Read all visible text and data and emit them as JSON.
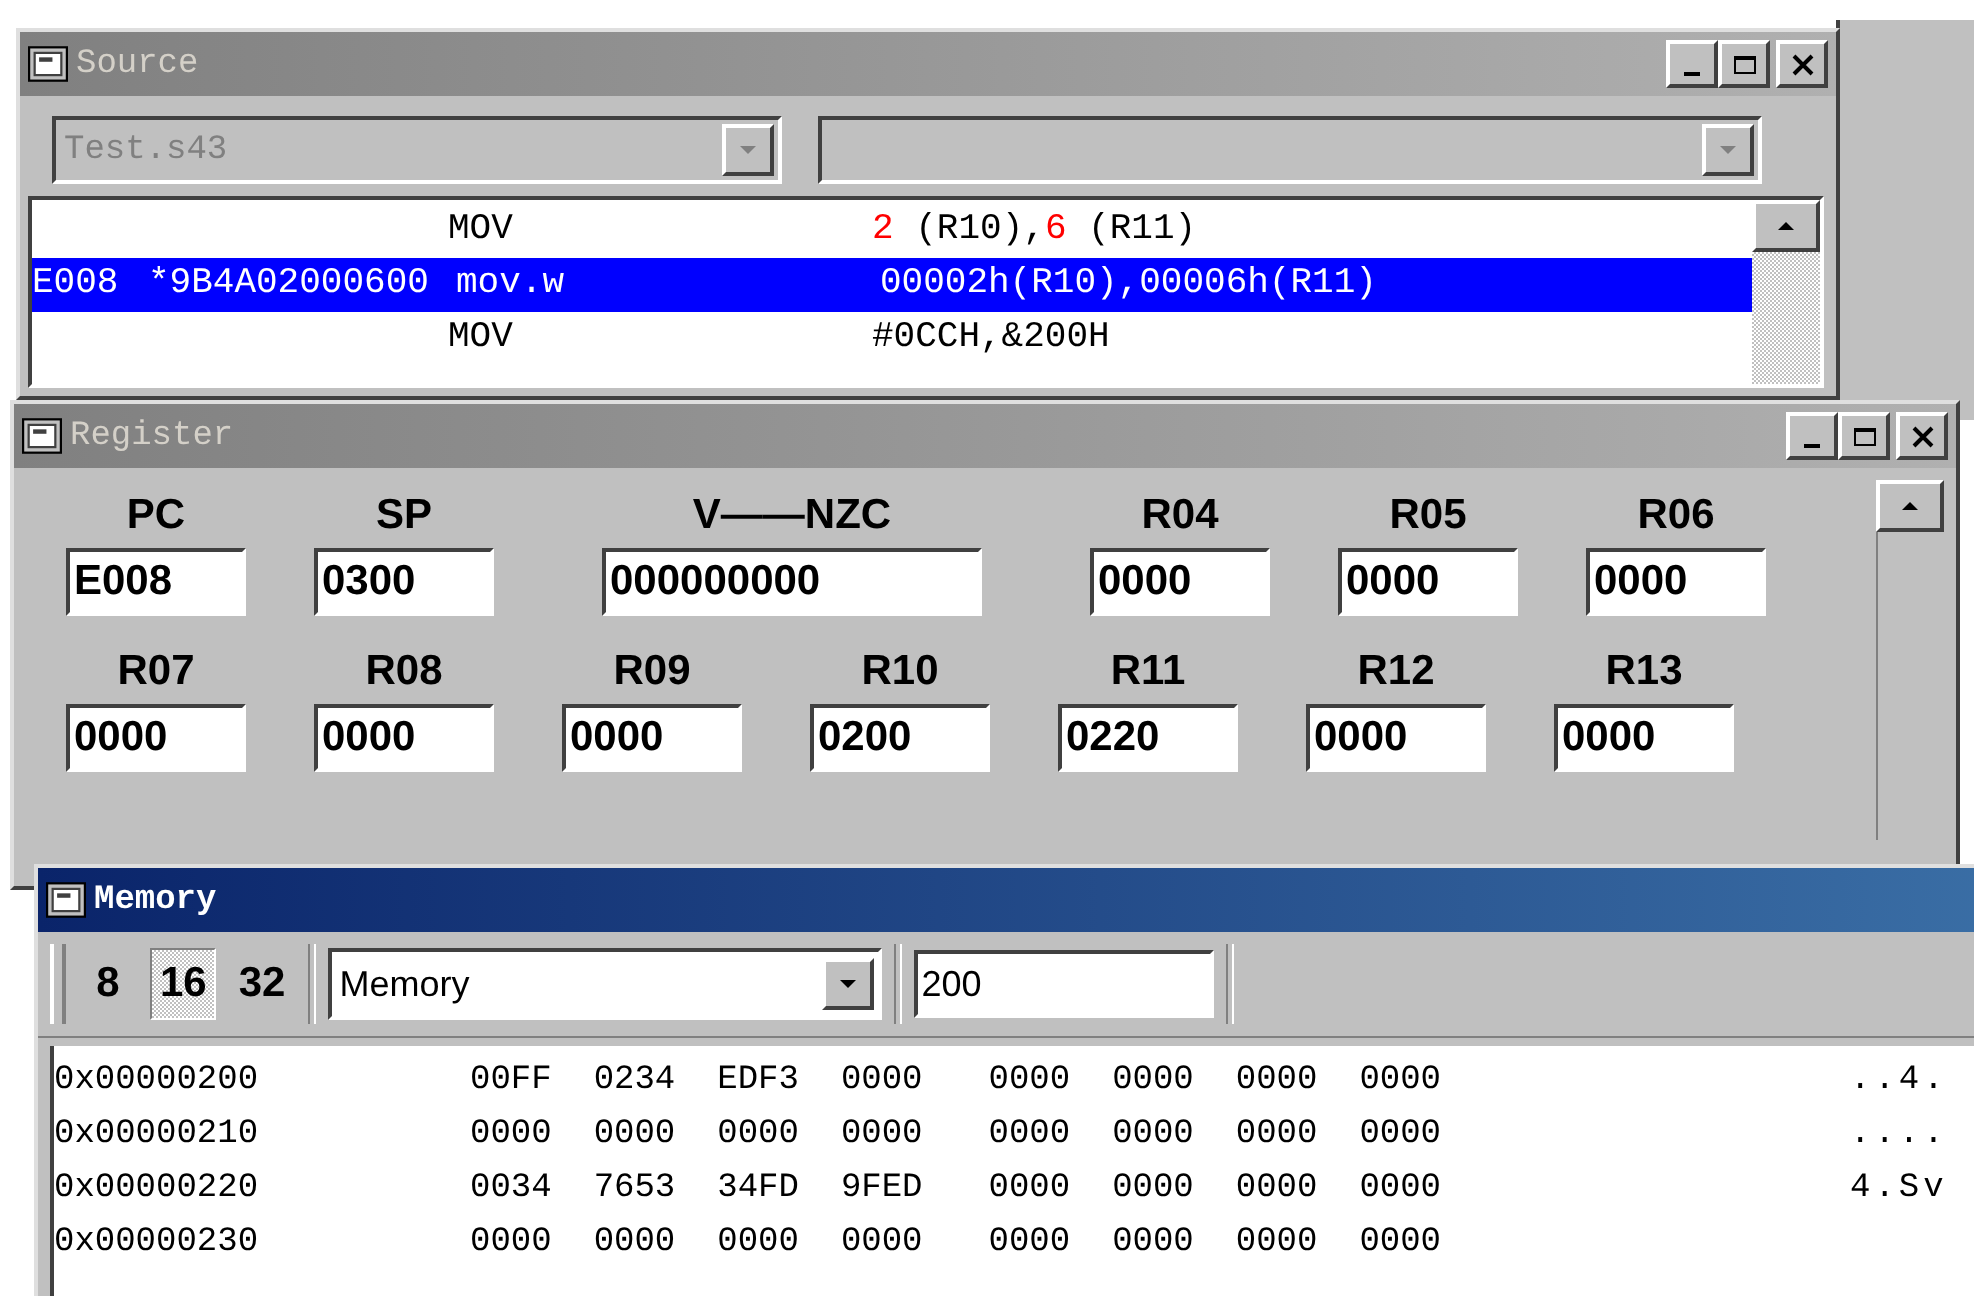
{
  "source": {
    "title": "Source",
    "active": false,
    "file_combo": {
      "value": "Test.s43",
      "disabled": true
    },
    "lines": [
      {
        "mnemonic": "MOV",
        "operands": [
          {
            "kind": "value",
            "text": "2"
          },
          {
            "kind": "plain",
            "text": " (R10),"
          },
          {
            "kind": "value",
            "text": "6"
          },
          {
            "kind": "plain",
            "text": " (R11)"
          }
        ],
        "selected": false
      },
      {
        "address": "E008",
        "code": "*9B4A02000600",
        "mnemonic": "mov.w",
        "operands": [
          {
            "kind": "plain",
            "text": "00002h(R10),00006h(R11)"
          }
        ],
        "selected": true
      },
      {
        "mnemonic": "MOV",
        "operands": [
          {
            "kind": "plain",
            "text": "#0CCH,&200H"
          }
        ],
        "selected": false
      }
    ]
  },
  "register": {
    "title": "Register",
    "active": false,
    "fields": [
      {
        "label": "PC",
        "value": "E008",
        "kind": "normal"
      },
      {
        "label": "SP",
        "value": "0300",
        "kind": "normal"
      },
      {
        "label": "V——NZC",
        "value": "000000000",
        "kind": "wide"
      },
      {
        "label": "R04",
        "value": "0000",
        "kind": "normal"
      },
      {
        "label": "R05",
        "value": "0000",
        "kind": "normal"
      },
      {
        "label": "R06",
        "value": "0000",
        "kind": "normal"
      },
      {
        "label": "R07",
        "value": "0000",
        "kind": "normal"
      },
      {
        "label": "R08",
        "value": "0000",
        "kind": "normal"
      },
      {
        "label": "R09",
        "value": "0000",
        "kind": "normal"
      },
      {
        "label": "R10",
        "value": "0200",
        "kind": "normal"
      },
      {
        "label": "R11",
        "value": "0220",
        "kind": "normal"
      },
      {
        "label": "R12",
        "value": "0000",
        "kind": "normal"
      },
      {
        "label": "R13",
        "value": "0000",
        "kind": "normal"
      }
    ]
  },
  "memory": {
    "title": "Memory",
    "active": true,
    "width_buttons": [
      {
        "label": "8",
        "selected": false
      },
      {
        "label": "16",
        "selected": true
      },
      {
        "label": "32",
        "selected": false
      }
    ],
    "space_combo": {
      "value": "Memory"
    },
    "address_field": {
      "value": "200"
    },
    "rows": [
      {
        "address": "0x00000200",
        "words": [
          "00FF",
          "0234",
          "EDF3",
          "0000",
          "0000",
          "0000",
          "0000",
          "0000"
        ],
        "ascii": "..4."
      },
      {
        "address": "0x00000210",
        "words": [
          "0000",
          "0000",
          "0000",
          "0000",
          "0000",
          "0000",
          "0000",
          "0000"
        ],
        "ascii": "...."
      },
      {
        "address": "0x00000220",
        "words": [
          "0034",
          "7653",
          "34FD",
          "9FED",
          "0000",
          "0000",
          "0000",
          "0000"
        ],
        "ascii": "4.Sv"
      },
      {
        "address": "0x00000230",
        "words": [
          "0000",
          "0000",
          "0000",
          "0000",
          "0000",
          "0000",
          "0000",
          "0000"
        ]
      }
    ]
  }
}
